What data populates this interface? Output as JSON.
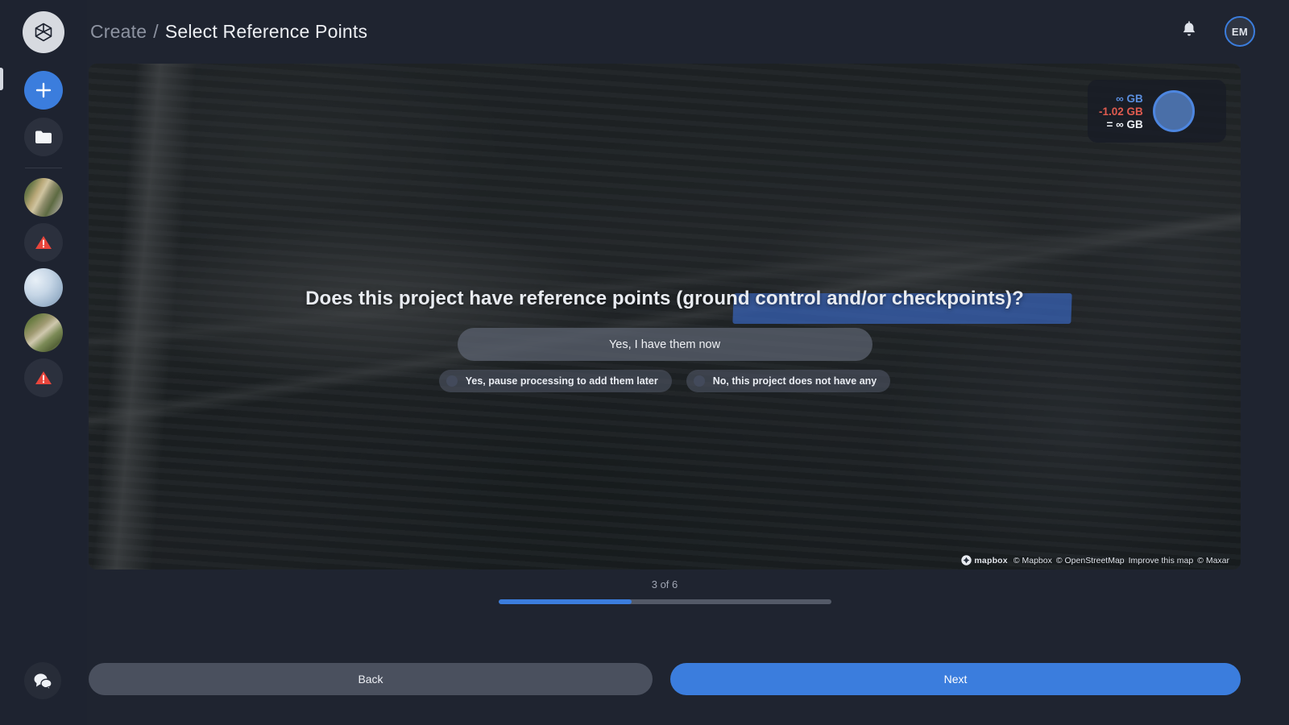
{
  "header": {
    "breadcrumb_parent": "Create",
    "breadcrumb_separator": "/",
    "breadcrumb_current": "Select Reference Points",
    "notifications_icon": "bell-icon",
    "avatar_initials": "EM",
    "logo_icon": "cube-logo-icon"
  },
  "sidebar": {
    "add_label": "+",
    "add_icon": "plus-icon",
    "folder_icon": "folder-icon",
    "items": [
      {
        "name": "project-thumbnail-1",
        "type": "thumbnail"
      },
      {
        "name": "project-warning-1",
        "type": "warning",
        "icon": "warning-triangle-icon"
      },
      {
        "name": "project-thumbnail-2",
        "type": "thumbnail"
      },
      {
        "name": "project-thumbnail-3",
        "type": "thumbnail"
      },
      {
        "name": "project-warning-2",
        "type": "warning",
        "icon": "warning-triangle-icon"
      }
    ],
    "support_icon": "chat-bubbles-icon"
  },
  "map": {
    "aoi_color": "#3c6ed2",
    "storage": {
      "total": "∞ GB",
      "used": "-1.02 GB",
      "remaining": "= ∞ GB",
      "total_color": "#5b8fe0",
      "used_color": "#e05b4f",
      "remaining_color": "#eef1f6"
    },
    "attribution": {
      "logo_text": "mapbox",
      "links": [
        "© Mapbox",
        "© OpenStreetMap",
        "Improve this map",
        "© Maxar"
      ]
    }
  },
  "question": {
    "title": "Does this project have reference points (ground control and/or checkpoints)?",
    "primary_option": "Yes, I have them now",
    "secondary_options": [
      "Yes, pause processing to add them later",
      "No, this project does not have any"
    ]
  },
  "progress": {
    "step_label": "3 of 6",
    "current_step": 3,
    "total_steps": 6,
    "fill_percent": 40,
    "fill_color": "#3b7ddd"
  },
  "footer": {
    "back_label": "Back",
    "next_label": "Next",
    "next_color": "#3b7ddd"
  }
}
